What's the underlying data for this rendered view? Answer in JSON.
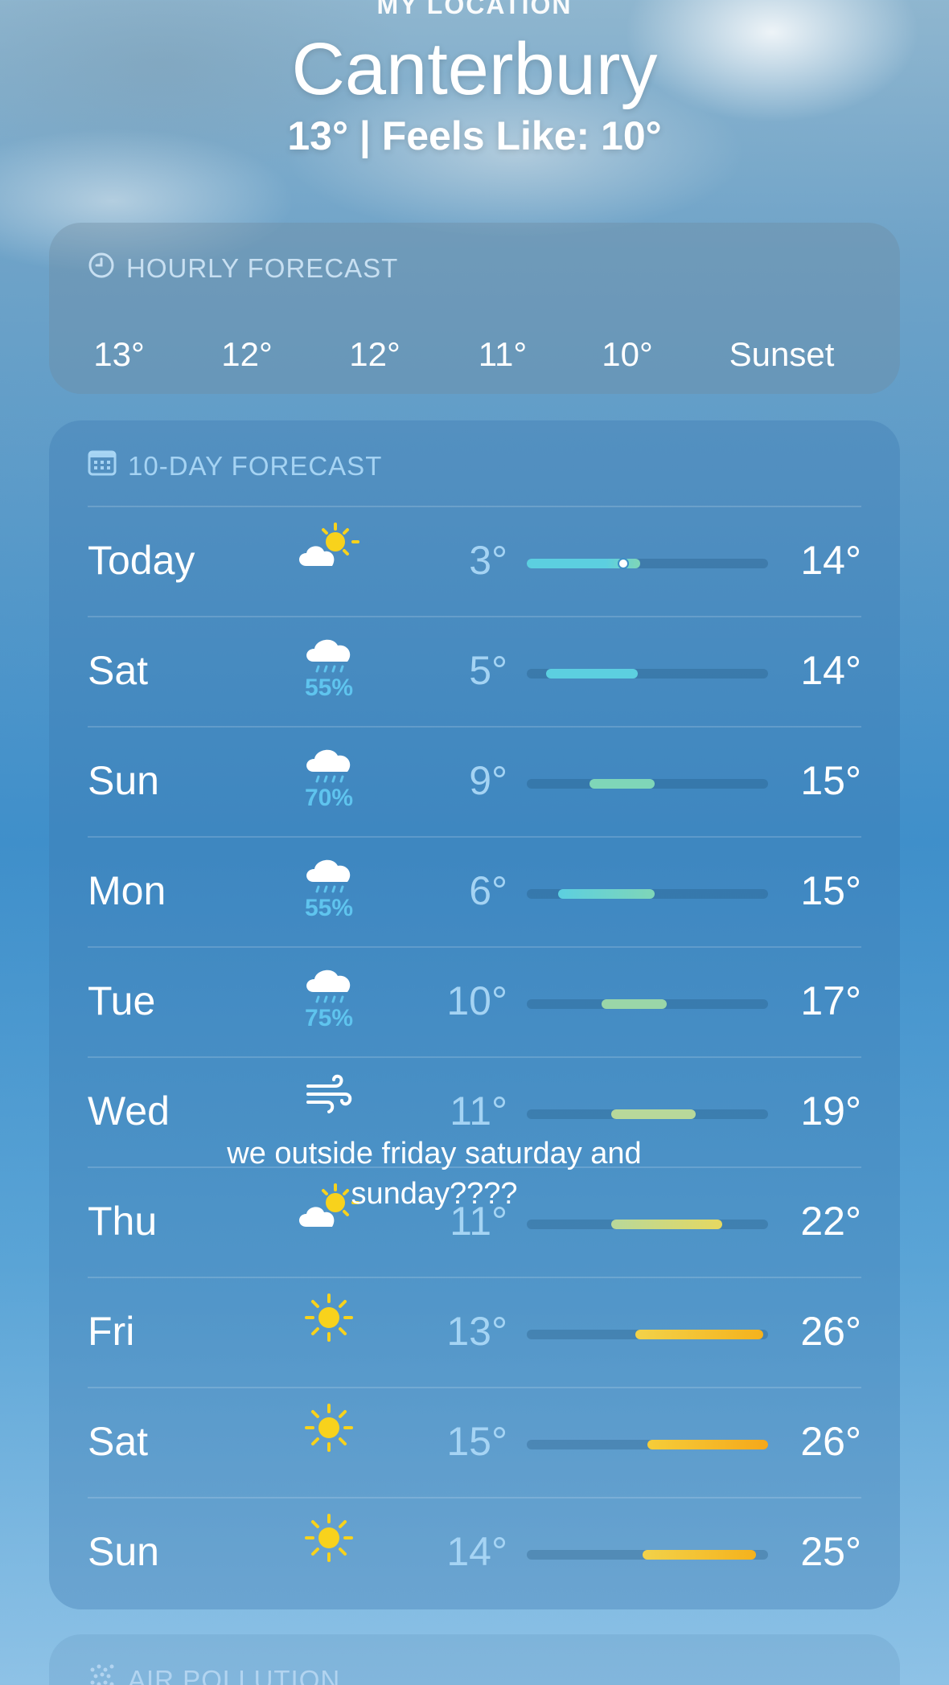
{
  "location_label": "MY LOCATION",
  "city": "Canterbury",
  "current_summary": "13°  |  Feels Like: 10°",
  "hourly": {
    "title": "HOURLY FORECAST",
    "items": [
      "13°",
      "12°",
      "12°",
      "11°",
      "10°",
      "Sunset"
    ]
  },
  "ten_day": {
    "title": "10-DAY FORECAST",
    "days": [
      {
        "day": "Today",
        "icon": "partly-sunny-icon",
        "precip": "",
        "low": "3°",
        "high": "14°",
        "bar_start": 0.0,
        "bar_end": 0.47,
        "bar_color": "linear-gradient(90deg,#5ccfe0,#5ccfe0 70%,#7fd6b8)",
        "current_position": 0.4
      },
      {
        "day": "Sat",
        "icon": "rain-icon",
        "precip": "55%",
        "low": "5°",
        "high": "14°",
        "bar_start": 0.08,
        "bar_end": 0.46,
        "bar_color": "#5ccfe0"
      },
      {
        "day": "Sun",
        "icon": "rain-icon",
        "precip": "70%",
        "low": "9°",
        "high": "15°",
        "bar_start": 0.26,
        "bar_end": 0.53,
        "bar_color": "#7fd6b8"
      },
      {
        "day": "Mon",
        "icon": "rain-icon",
        "precip": "55%",
        "low": "6°",
        "high": "15°",
        "bar_start": 0.13,
        "bar_end": 0.53,
        "bar_color": "linear-gradient(90deg,#5ccfe0,#7fd6b8)"
      },
      {
        "day": "Tue",
        "icon": "rain-icon",
        "precip": "75%",
        "low": "10°",
        "high": "17°",
        "bar_start": 0.31,
        "bar_end": 0.58,
        "bar_color": "#9ad6a8"
      },
      {
        "day": "Wed",
        "icon": "wind-icon",
        "precip": "",
        "low": "11°",
        "high": "19°",
        "bar_start": 0.35,
        "bar_end": 0.7,
        "bar_color": "#b8d89a"
      },
      {
        "day": "Thu",
        "icon": "partly-sunny-icon",
        "precip": "",
        "low": "11°",
        "high": "22°",
        "bar_start": 0.35,
        "bar_end": 0.81,
        "bar_color": "linear-gradient(90deg,#b8d89a,#e6d860)"
      },
      {
        "day": "Fri",
        "icon": "sun-icon",
        "precip": "",
        "low": "13°",
        "high": "26°",
        "bar_start": 0.45,
        "bar_end": 0.98,
        "bar_color": "linear-gradient(90deg,#f2d24a,#f5b21c)"
      },
      {
        "day": "Sat",
        "icon": "sun-icon",
        "precip": "",
        "low": "15°",
        "high": "26°",
        "bar_start": 0.5,
        "bar_end": 1.0,
        "bar_color": "linear-gradient(90deg,#f5cd3a,#f5a81a)"
      },
      {
        "day": "Sun",
        "icon": "sun-icon",
        "precip": "",
        "low": "14°",
        "high": "25°",
        "bar_start": 0.48,
        "bar_end": 0.95,
        "bar_color": "linear-gradient(90deg,#f2d24a,#f5b21c)"
      }
    ]
  },
  "air": {
    "title": "AIR POLLUTION"
  },
  "overlay_caption": "we outside friday saturday and sunday????"
}
